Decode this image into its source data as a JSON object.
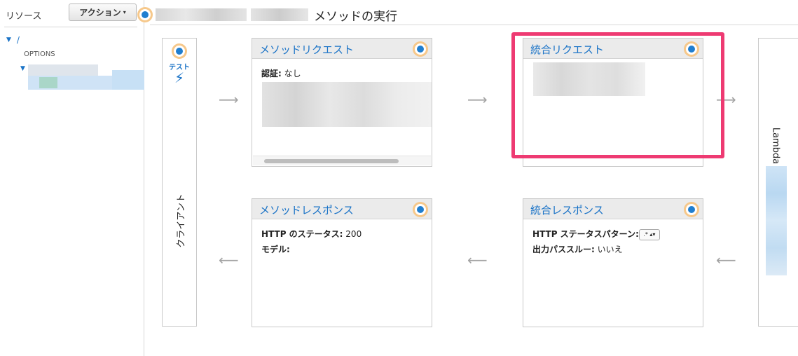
{
  "sidebar": {
    "title": "リソース",
    "action_button": "アクション",
    "action_caret": "▾",
    "tree": {
      "root": "/",
      "options": "OPTIONS"
    }
  },
  "header": {
    "title": "メソッドの実行"
  },
  "client": {
    "test_label": "テスト",
    "label": "クライアント",
    "bolt_icon": "⚡"
  },
  "lambda": {
    "label": "Lambda"
  },
  "method_request": {
    "title": "メソッドリクエスト",
    "auth_label": "認証:",
    "auth_value": "なし"
  },
  "integration_request": {
    "title": "統合リクエスト"
  },
  "method_response": {
    "title": "メソッドレスポンス",
    "status_label": "HTTP のステータス:",
    "status_value": "200",
    "model_label": "モデル:"
  },
  "integration_response": {
    "title": "統合レスポンス",
    "pattern_label": "HTTP ステータスパターン:",
    "pattern_value": ".*",
    "passthrough_label": "出力パススルー:",
    "passthrough_value": "いいえ"
  },
  "arrows": {
    "right": "⟶",
    "left": "⟵"
  },
  "colors": {
    "link": "#1a73c7",
    "highlight": "#ee3a72",
    "dot": "#1f7ed0",
    "dot_ring": "#f6c88b"
  }
}
